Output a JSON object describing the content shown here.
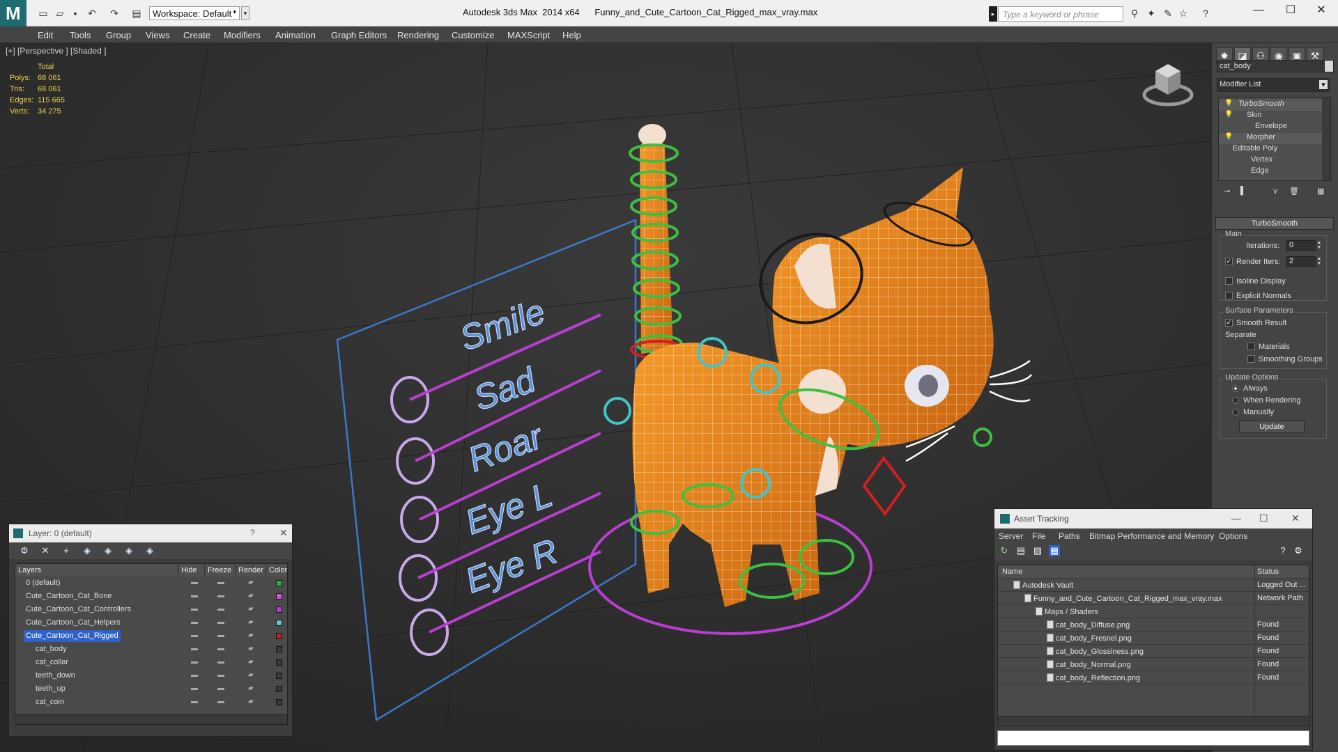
{
  "titlebar": {
    "app_title": "Autodesk 3ds Max  2014 x64",
    "file_name": "Funny_and_Cute_Cartoon_Cat_Rigged_max_vray.max",
    "workspace": "Workspace: Default",
    "search_placeholder": "Type a keyword or phrase"
  },
  "menu": [
    "Edit",
    "Tools",
    "Group",
    "Views",
    "Create",
    "Modifiers",
    "Animation",
    "Graph Editors",
    "Rendering",
    "Customize",
    "MAXScript",
    "Help"
  ],
  "viewport": {
    "label": "[+] [Perspective ] [Shaded ]",
    "stats_header": "Total",
    "stats": [
      {
        "key": "Polys:",
        "value": "68 061"
      },
      {
        "key": "Tris:",
        "value": "68 061"
      },
      {
        "key": "Edges:",
        "value": "115 665"
      },
      {
        "key": "Verts:",
        "value": "34 275"
      }
    ],
    "board_labels": [
      "Smile",
      "Sad",
      "Roar",
      "Eye L",
      "Eye R"
    ]
  },
  "command_panel": {
    "object_name": "cat_body",
    "modifier_list": "Modifier List",
    "stack": [
      "TurboSmooth",
      "Skin",
      "Envelope",
      "Morpher",
      "Editable Poly",
      "Vertex",
      "Edge"
    ],
    "rollout_title": "TurboSmooth",
    "main_group": "Main",
    "iterations_label": "Iterations:",
    "iterations_value": "0",
    "render_iters_label": "Render Iters:",
    "render_iters_value": "2",
    "isoline": "Isoline Display",
    "explicit_normals": "Explicit Normals",
    "surface_group": "Surface Parameters",
    "smooth_result": "Smooth Result",
    "separate": "Separate",
    "materials": "Materials",
    "smoothing_groups": "Smoothing Groups",
    "update_group": "Update Options",
    "always": "Always",
    "when_rendering": "When Rendering",
    "manually": "Manually",
    "update_btn": "Update"
  },
  "layer_dialog": {
    "title": "Layer: 0 (default)",
    "help": "?",
    "close": "✕",
    "columns": {
      "layers": "Layers",
      "hide": "Hide",
      "freeze": "Freeze",
      "render": "Render",
      "color": "Color"
    },
    "rows": [
      {
        "name": "0 (default)",
        "color": "#2fae4a",
        "indent": 0
      },
      {
        "name": "Cute_Cartoon_Cat_Bone",
        "color": "#d84fd8",
        "indent": 0
      },
      {
        "name": "Cute_Cartoon_Cat_Controllers",
        "color": "#b040c8",
        "indent": 0
      },
      {
        "name": "Cute_Cartoon_Cat_Helpers",
        "color": "#60c8d0",
        "indent": 0
      },
      {
        "name": "Cute_Cartoon_Cat_Rigged",
        "color": "#c02020",
        "indent": 0
      },
      {
        "name": "cat_body",
        "color": "#3a3a3a",
        "indent": 1
      },
      {
        "name": "cat_collar",
        "color": "#3a3a3a",
        "indent": 1
      },
      {
        "name": "teeth_down",
        "color": "#3a3a3a",
        "indent": 1
      },
      {
        "name": "teeth_up",
        "color": "#3a3a3a",
        "indent": 1
      },
      {
        "name": "cat_coin",
        "color": "#3a3a3a",
        "indent": 1
      }
    ]
  },
  "asset_tracking": {
    "title": "Asset Tracking",
    "menu": [
      "Server",
      "File",
      "Paths",
      "Bitmap Performance and Memory",
      "Options"
    ],
    "col_name": "Name",
    "col_status": "Status",
    "rows": [
      {
        "name": "Autodesk Vault",
        "status": "Logged Out ...",
        "indent": 1
      },
      {
        "name": "Funny_and_Cute_Cartoon_Cat_Rigged_max_vray.max",
        "status": "Network Path",
        "indent": 2
      },
      {
        "name": "Maps / Shaders",
        "status": "",
        "indent": 3
      },
      {
        "name": "cat_body_Diffuse.png",
        "status": "Found",
        "indent": 4
      },
      {
        "name": "cat_body_Fresnel.png",
        "status": "Found",
        "indent": 4
      },
      {
        "name": "cat_body_Glossiness.png",
        "status": "Found",
        "indent": 4
      },
      {
        "name": "cat_body_Normal.png",
        "status": "Found",
        "indent": 4
      },
      {
        "name": "cat_body_Reflection.png",
        "status": "Found",
        "indent": 4
      }
    ]
  },
  "colors": {
    "cat_orange": "#e8821a",
    "rig_green": "#3fbf3f",
    "rig_cyan": "#3fc6c8",
    "rig_magenta": "#b83fd0",
    "board_blue": "#3c78c8"
  }
}
